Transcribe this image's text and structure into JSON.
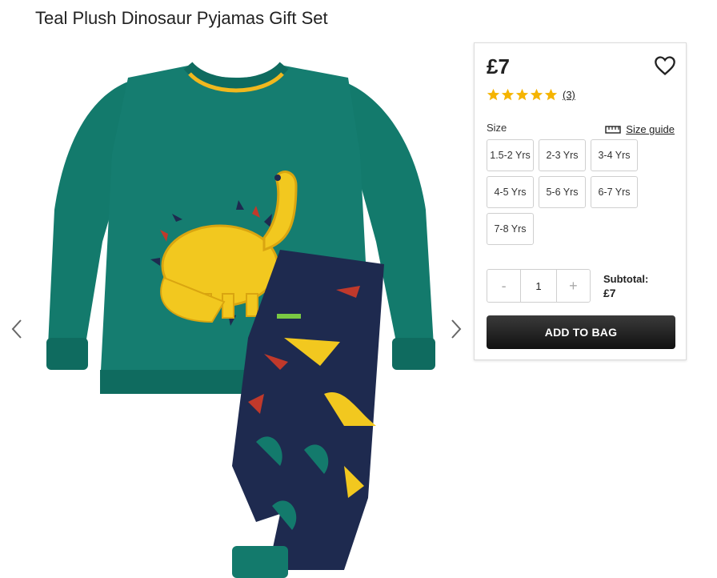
{
  "product": {
    "title": "Teal Plush Dinosaur Pyjamas Gift Set"
  },
  "gallery": {
    "prev_icon": "chevron-left-icon",
    "next_icon": "chevron-right-icon"
  },
  "panel": {
    "price": "£7",
    "wishlist_icon": "heart-outline-icon",
    "rating": {
      "stars": 5,
      "count": "(3)",
      "star_color": "#f5b400"
    },
    "size_label": "Size",
    "size_guide_label": "Size guide",
    "sizes": [
      "1.5-2 Yrs",
      "2-3 Yrs",
      "3-4 Yrs",
      "4-5 Yrs",
      "5-6 Yrs",
      "6-7 Yrs",
      "7-8 Yrs"
    ],
    "quantity": {
      "minus": "-",
      "value": "1",
      "plus": "+"
    },
    "subtotal_label": "Subtotal:",
    "subtotal_value": "£7",
    "add_to_bag_label": "ADD TO BAG"
  },
  "colors": {
    "shirt": "#137a6c",
    "trim": "#f0b81e",
    "dino": "#f2c81f",
    "pants": "#1e2a4f"
  }
}
